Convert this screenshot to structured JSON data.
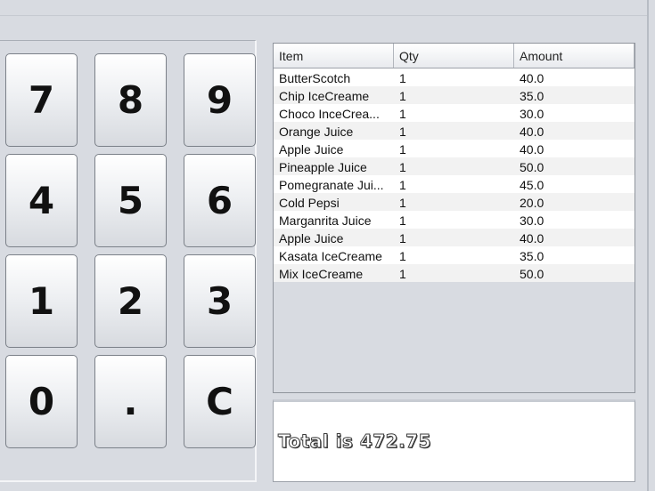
{
  "keypad": {
    "keys": [
      "7",
      "8",
      "9",
      "4",
      "5",
      "6",
      "1",
      "2",
      "3",
      "0",
      ".",
      "C"
    ]
  },
  "table": {
    "columns": [
      "Item",
      "Qty",
      "Amount"
    ],
    "rows": [
      [
        "ButterScotch",
        "1",
        "40.0"
      ],
      [
        "Chip IceCreame",
        "1",
        "35.0"
      ],
      [
        "Choco InceCrea...",
        "1",
        "30.0"
      ],
      [
        "Orange Juice",
        "1",
        "40.0"
      ],
      [
        "Apple Juice",
        "1",
        "40.0"
      ],
      [
        "Pineapple Juice",
        "1",
        "50.0"
      ],
      [
        "Pomegranate Jui...",
        "1",
        "45.0"
      ],
      [
        "Cold Pepsi",
        "1",
        "20.0"
      ],
      [
        "Marganrita Juice",
        "1",
        "30.0"
      ],
      [
        "Apple Juice",
        "1",
        "40.0"
      ],
      [
        "Kasata IceCreame",
        "1",
        "35.0"
      ],
      [
        "Mix IceCreame",
        "1",
        "50.0"
      ]
    ]
  },
  "total": {
    "text": "Total is 472.75"
  }
}
